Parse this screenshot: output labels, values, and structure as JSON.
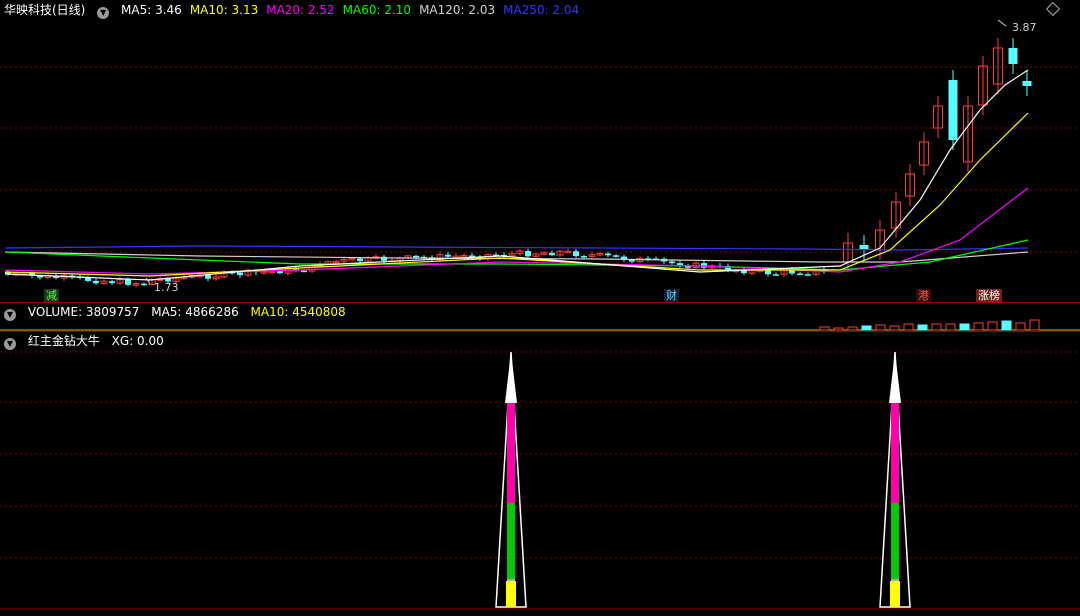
{
  "main": {
    "title": "华映科技(日线)",
    "ma": [
      {
        "label": "MA5: 3.46",
        "color": "#ffffff"
      },
      {
        "label": "MA10: 3.13",
        "color": "#ffff00"
      },
      {
        "label": "MA20: 2.52",
        "color": "#ff00ff"
      },
      {
        "label": "MA60: 2.10",
        "color": "#00ff00"
      },
      {
        "label": "MA120: 2.03",
        "color": "#d0d0d0"
      },
      {
        "label": "MA250: 2.04",
        "color": "#3333ff"
      }
    ],
    "high_label": "3.87",
    "low_label": "1.73",
    "badges": [
      {
        "text": "减",
        "color": "#55ff55",
        "bg": "#1a3a1a"
      },
      {
        "text": "财",
        "color": "#66ccff",
        "bg": "#102030"
      },
      {
        "text": "港",
        "color": "#ff5050",
        "bg": "#3a0a0a"
      },
      {
        "text": "涨榜",
        "color": "#ffffff",
        "bg": "#7a1a1a"
      }
    ]
  },
  "volume": {
    "label": "VOLUME: 3809757",
    "ma5": "MA5: 4866286",
    "ma10": "MA10: 4540808"
  },
  "indicator": {
    "name": "红主金钻大牛",
    "xg": "XG: 0.00"
  },
  "colors": {
    "up": "#ff3b3b",
    "down": "#54ffff",
    "grid": "#8b0000"
  }
}
